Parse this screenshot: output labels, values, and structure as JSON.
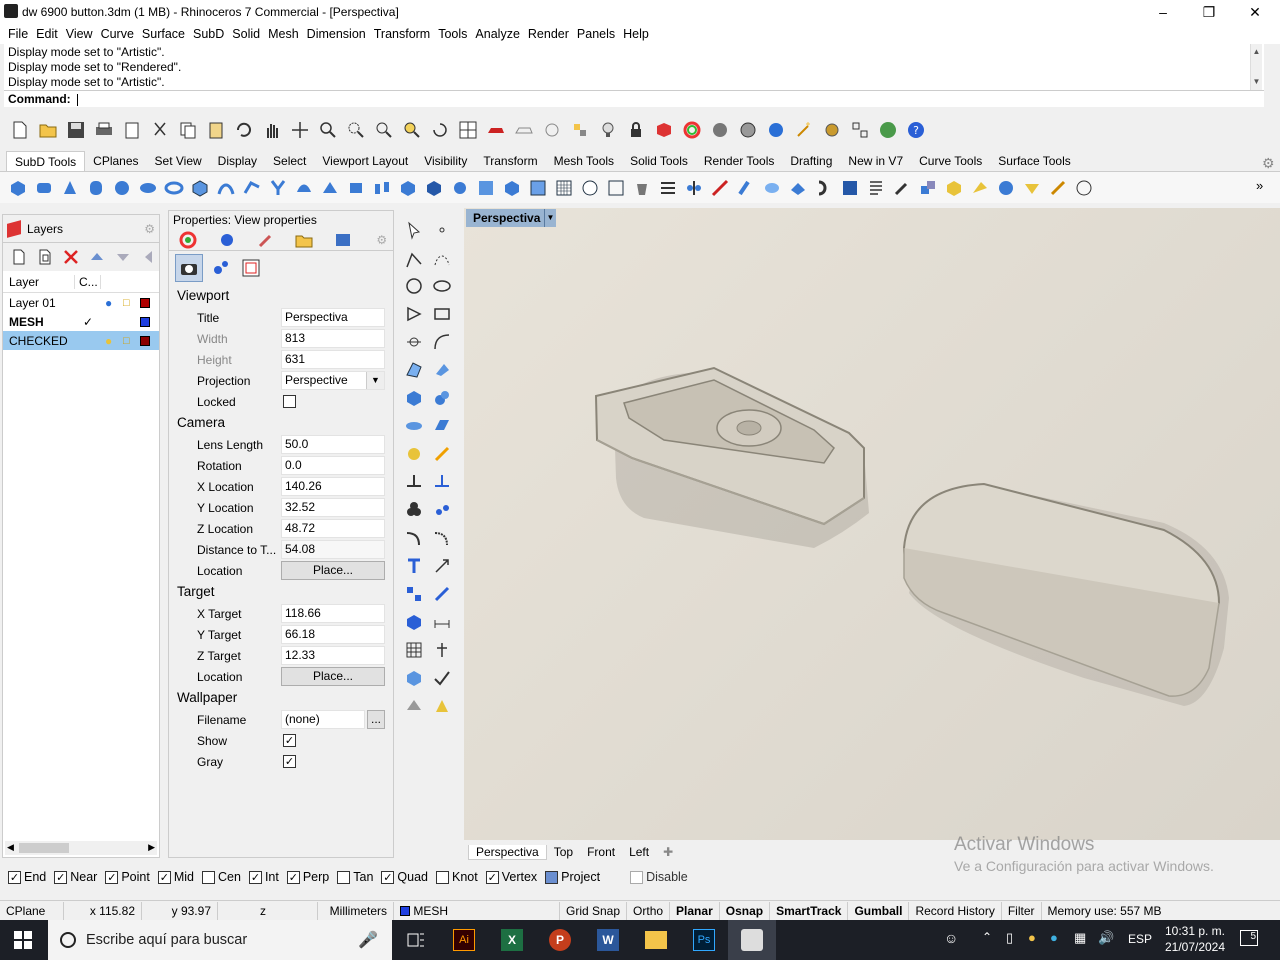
{
  "window": {
    "title": "dw 6900 button.3dm (1 MB) - Rhinoceros 7 Commercial - [Perspectiva]"
  },
  "menu": [
    "File",
    "Edit",
    "View",
    "Curve",
    "Surface",
    "SubD",
    "Solid",
    "Mesh",
    "Dimension",
    "Transform",
    "Tools",
    "Analyze",
    "Render",
    "Panels",
    "Help"
  ],
  "command": {
    "history": [
      "Display mode set to \"Artistic\".",
      "Display mode set to \"Rendered\".",
      "Display mode set to \"Artistic\"."
    ],
    "prompt": "Command:"
  },
  "tabs": [
    "SubD Tools",
    "CPlanes",
    "Set View",
    "Display",
    "Select",
    "Viewport Layout",
    "Visibility",
    "Transform",
    "Mesh Tools",
    "Solid Tools",
    "Render Tools",
    "Drafting",
    "New in V7",
    "Curve Tools",
    "Surface Tools"
  ],
  "layers": {
    "title": "Layers",
    "col_layer": "Layer",
    "col_c": "C...",
    "rows": [
      {
        "name": "Layer 01",
        "color": "#b00000",
        "current": false
      },
      {
        "name": "MESH",
        "color": "#1f3fe0",
        "current": true
      },
      {
        "name": "CHECKED",
        "color": "#8b0000",
        "current": false
      }
    ]
  },
  "properties": {
    "title": "Properties: View properties",
    "viewport": {
      "section": "Viewport",
      "title_label": "Title",
      "title": "Perspectiva",
      "width_label": "Width",
      "width": "813",
      "height_label": "Height",
      "height": "631",
      "projection_label": "Projection",
      "projection": "Perspective",
      "locked_label": "Locked"
    },
    "camera": {
      "section": "Camera",
      "lens_label": "Lens Length",
      "lens": "50.0",
      "rotation_label": "Rotation",
      "rotation": "0.0",
      "xloc_label": "X Location",
      "xloc": "140.26",
      "yloc_label": "Y Location",
      "yloc": "32.52",
      "zloc_label": "Z Location",
      "zloc": "48.72",
      "dist_label": "Distance to T...",
      "dist": "54.08",
      "loc_label": "Location",
      "place": "Place..."
    },
    "target": {
      "section": "Target",
      "x_label": "X Target",
      "x": "118.66",
      "y_label": "Y Target",
      "y": "66.18",
      "z_label": "Z Target",
      "z": "12.33",
      "loc_label": "Location",
      "place": "Place..."
    },
    "wallpaper": {
      "section": "Wallpaper",
      "file_label": "Filename",
      "file": "(none)",
      "browse": "...",
      "show_label": "Show",
      "gray_label": "Gray"
    }
  },
  "viewport": {
    "active": "Perspectiva",
    "tabs": [
      "Perspectiva",
      "Top",
      "Front",
      "Left"
    ]
  },
  "osnap": {
    "items": [
      {
        "label": "End",
        "checked": true
      },
      {
        "label": "Near",
        "checked": true
      },
      {
        "label": "Point",
        "checked": true
      },
      {
        "label": "Mid",
        "checked": true
      },
      {
        "label": "Cen",
        "checked": false
      },
      {
        "label": "Int",
        "checked": true
      },
      {
        "label": "Perp",
        "checked": true
      },
      {
        "label": "Tan",
        "checked": false
      },
      {
        "label": "Quad",
        "checked": true
      },
      {
        "label": "Knot",
        "checked": false
      },
      {
        "label": "Vertex",
        "checked": true
      }
    ],
    "project": "Project",
    "disable": "Disable"
  },
  "status": {
    "cplane": "CPlane",
    "x": "x 115.82",
    "y": "y 93.97",
    "z": "z",
    "units": "Millimeters",
    "layer": "MESH",
    "grid_snap": "Grid Snap",
    "ortho": "Ortho",
    "planar": "Planar",
    "osnap": "Osnap",
    "smarttrack": "SmartTrack",
    "gumball": "Gumball",
    "record": "Record History",
    "filter": "Filter",
    "memory": "Memory use: 557 MB"
  },
  "watermark": {
    "line1": "Activar Windows",
    "line2": "Ve a Configuración para activar Windows."
  },
  "taskbar": {
    "search": "Escribe aquí para buscar",
    "lang": "ESP",
    "time": "10:31 p. m.",
    "date": "21/07/2024",
    "notif": "5"
  },
  "colors": {
    "accent": "#99c9ef",
    "vp_tab": "#99b4d1",
    "taskbar": "#1c1f26"
  }
}
